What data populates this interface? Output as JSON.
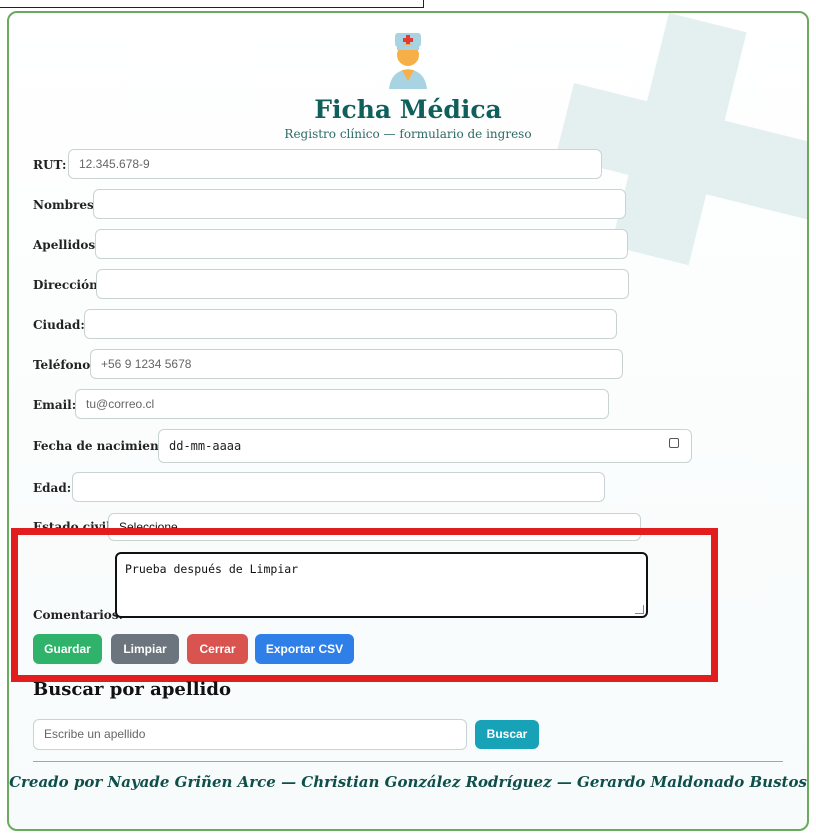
{
  "header": {
    "title": "Ficha Médica",
    "subtitle": "Registro clínico — formulario de ingreso",
    "icon": "doctor-icon"
  },
  "form": {
    "rut": {
      "label": "RUT:",
      "placeholder": "12.345.678-9",
      "value": ""
    },
    "nombres": {
      "label": "Nombres:",
      "value": ""
    },
    "apellidos": {
      "label": "Apellidos:",
      "value": ""
    },
    "direccion": {
      "label": "Dirección:",
      "value": ""
    },
    "ciudad": {
      "label": "Ciudad:",
      "value": ""
    },
    "telefono": {
      "label": "Teléfono:",
      "placeholder": "+56 9 1234 5678",
      "value": ""
    },
    "email": {
      "label": "Email:",
      "placeholder": "tu@correo.cl",
      "value": ""
    },
    "fecha_nacimiento": {
      "label": "Fecha de nacimiento:",
      "value": "dd-mm-aaaa"
    },
    "edad": {
      "label": "Edad:",
      "value": ""
    },
    "estado_civil": {
      "label": "Estado civil:",
      "selected": "Seleccione"
    },
    "comentarios": {
      "label": "Comentarios:",
      "value": "Prueba después de Limpiar"
    }
  },
  "buttons": {
    "guardar": "Guardar",
    "limpiar": "Limpiar",
    "cerrar": "Cerrar",
    "exportar": "Exportar CSV"
  },
  "search": {
    "title": "Buscar por apellido",
    "placeholder": "Escribe un apellido",
    "button": "Buscar"
  },
  "footer": "Creado por Nayade Griñen Arce — Christian González Rodríguez — Gerardo Maldonado Bustos",
  "colors": {
    "accent": "#0f5f5a",
    "border": "#6aaa5c",
    "highlight": "#e11d1d"
  }
}
